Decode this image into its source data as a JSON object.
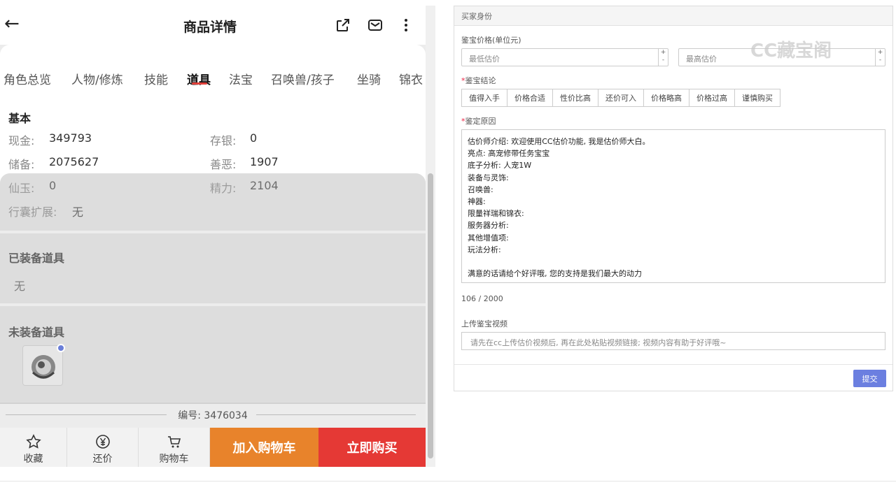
{
  "phone": {
    "header": {
      "title": "商品详情"
    },
    "tabs": [
      {
        "label": "角色总览"
      },
      {
        "label": "人物/修炼"
      },
      {
        "label": "技能"
      },
      {
        "label": "道具"
      },
      {
        "label": "法宝"
      },
      {
        "label": "召唤兽/孩子"
      },
      {
        "label": "坐骑"
      },
      {
        "label": "锦衣"
      }
    ],
    "basic": {
      "title": "基本",
      "cash_label": "现金:",
      "cash": "349793",
      "deposit_label": "存银:",
      "deposit": "0",
      "reserve_label": "储备:",
      "reserve": "2075627",
      "karma_label": "善恶:",
      "karma": "1907",
      "jade_label": "仙玉:",
      "jade": "0",
      "energy_label": "精力:",
      "energy": "2104",
      "bag_label": "行囊扩展:",
      "bag": "无"
    },
    "equipped": {
      "title": "已装备道具",
      "value": "无"
    },
    "unequipped": {
      "title": "未装备道具"
    },
    "serial": "编号: 3476034",
    "bottom": {
      "fav": "收藏",
      "bargain": "还价",
      "cart": "购物车",
      "add_cart": "加入购物车",
      "buy_now": "立即购买"
    }
  },
  "form": {
    "section_title": "买家身份",
    "price_label": "鉴宝价格(单位元)",
    "min_placeholder": "最低估价",
    "max_placeholder": "最高估价",
    "conclusion_label": "鉴宝结论",
    "conclusions": [
      "值得入手",
      "价格合适",
      "性价比高",
      "还价可入",
      "价格略高",
      "价格过高",
      "谨慎购买"
    ],
    "reason_label": "鉴定原因",
    "reason_text": "估价师介绍: 欢迎使用CC估价功能, 我是估价师大白。\n亮点: 高宠修带任务宝宝\n底子分析: 人宠1W\n装备与灵饰:\n召唤兽:\n神器:\n限量祥瑞和锦衣:\n服务器分析:\n其他增值项:\n玩法分析:\n\n满意的话请给个好评哦, 您的支持是我们最大的动力",
    "counter": "106 / 2000",
    "video_label": "上传鉴宝视频",
    "video_placeholder": "请先在cc上传估价视频后, 再在此处粘贴视频链接; 视频内容有助于好评哦~",
    "submit": "提交",
    "watermark": "CC藏宝阁"
  },
  "colors": {
    "accent_red": "#e53935",
    "accent_orange": "#e8832b",
    "submit_blue": "#6b7fe0"
  }
}
